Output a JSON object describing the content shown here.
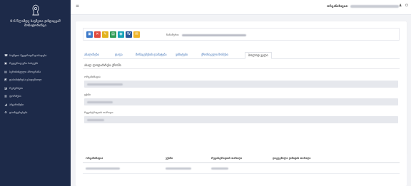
{
  "sidebar": {
    "brand_title": "0-6 წლამდე ბავშვთა ჯანდაცვამ მონიტორინგი",
    "items": [
      {
        "label": "ბავშვთა მკვდრადშ დაბადება",
        "icon": "phone-icon"
      },
      {
        "label": "რეფერალური სისტემა",
        "icon": "users-icon"
      },
      {
        "label": "სკრინინგული პროგრამა",
        "icon": "list-icon"
      },
      {
        "label": "დაბინძურება ეპიდემიოლ",
        "icon": "bed-icon"
      },
      {
        "label": "რესურსები",
        "icon": "pill-icon"
      },
      {
        "label": "ფორმები",
        "icon": "chart-icon"
      },
      {
        "label": "ანგარიშები",
        "icon": "bars-icon"
      },
      {
        "label": "დაინტერესება",
        "icon": "gear-icon"
      }
    ]
  },
  "topbar": {
    "menu_icon": "≡",
    "org_label": "ორგანიზაცია:"
  },
  "toolbar": {
    "buttons": [
      {
        "name": "save",
        "color": "#3a78c9",
        "glyph": "💾"
      },
      {
        "name": "delete",
        "color": "#e04a3f",
        "glyph": "✕"
      },
      {
        "name": "edit",
        "color": "#e3b21e",
        "glyph": "✎"
      },
      {
        "name": "add",
        "color": "#2e9c55",
        "glyph": "▤"
      },
      {
        "name": "view",
        "color": "#17a2b8",
        "glyph": "⚑"
      },
      {
        "name": "word",
        "color": "#2b579a",
        "glyph": "W"
      },
      {
        "name": "folder",
        "color": "#f0b429",
        "glyph": "✉"
      }
    ],
    "record_label": "ჩანაწერი:"
  },
  "tabs": [
    {
      "label": "ანალიზები"
    },
    {
      "label": "დაფა"
    },
    {
      "label": "მონაცემების დამატება"
    },
    {
      "label": "ვიზიტები"
    },
    {
      "label": "ქრონიკული ზომები"
    },
    {
      "label": "ბოლოდ ველი"
    }
  ],
  "active_tab_index": 5,
  "section": {
    "title": "ახალ ლოდაძირება ქროში"
  },
  "fields": [
    {
      "label": "ორგანიზაცია"
    },
    {
      "label": "ექიმი"
    },
    {
      "label": "რეგისტრაციის თარიღი"
    }
  ],
  "table": {
    "headers": [
      "ორგანიზაცია",
      "ექიმი",
      "რეგისტრაციის თარიღი",
      "დაგეგმილი ვიზიტის თარიღი"
    ]
  }
}
